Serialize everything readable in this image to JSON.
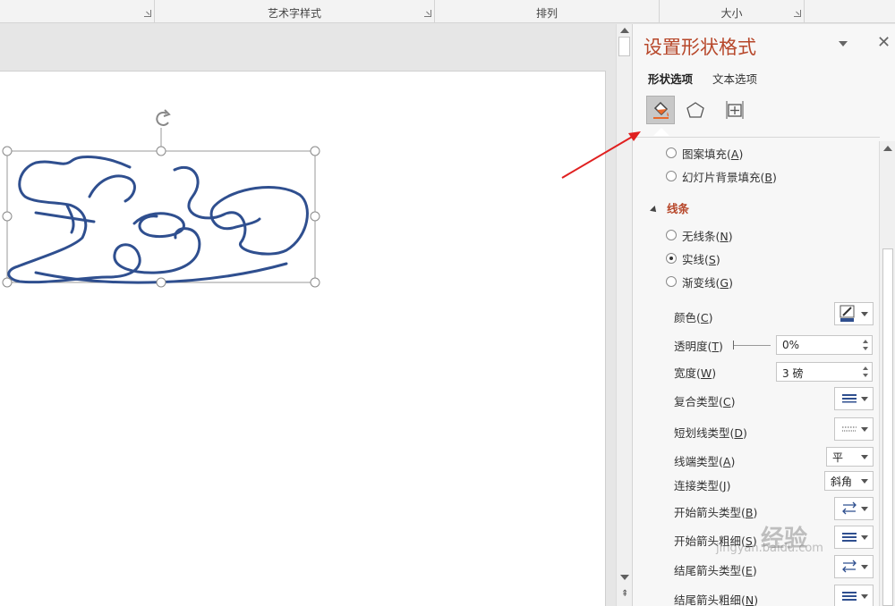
{
  "ribbon": {
    "groups": [
      {
        "label": ""
      },
      {
        "label": "艺术字样式"
      },
      {
        "label": "排列"
      },
      {
        "label": "大小"
      }
    ]
  },
  "pane": {
    "title": "设置形状格式",
    "tabs": {
      "shape": "形状选项",
      "text": "文本选项"
    },
    "icons": [
      "fill-line-icon",
      "effects-pentagon-icon",
      "size-properties-icon"
    ],
    "fill_options": [
      {
        "label": "图案填充",
        "key": "A",
        "selected": false
      },
      {
        "label": "幻灯片背景填充",
        "key": "B",
        "selected": false
      }
    ],
    "line_section": "线条",
    "line_options": [
      {
        "label": "无线条",
        "key": "N",
        "selected": false
      },
      {
        "label": "实线",
        "key": "S",
        "selected": true
      },
      {
        "label": "渐变线",
        "key": "G",
        "selected": false
      }
    ],
    "props": {
      "color": {
        "label": "颜色",
        "key": "C"
      },
      "transparency": {
        "label": "透明度",
        "key": "T",
        "value": "0%"
      },
      "width": {
        "label": "宽度",
        "key": "W",
        "value": "3 磅"
      },
      "compound": {
        "label": "复合类型",
        "key": "C"
      },
      "dash": {
        "label": "短划线类型",
        "key": "D"
      },
      "cap": {
        "label": "线端类型",
        "key": "A",
        "value": "平"
      },
      "join": {
        "label": "连接类型",
        "key": "J",
        "value": "斜角"
      },
      "begin_arrow_type": {
        "label": "开始箭头类型",
        "key": "B"
      },
      "begin_arrow_size": {
        "label": "开始箭头粗细",
        "key": "S"
      },
      "end_arrow_type": {
        "label": "结尾箭头类型",
        "key": "E"
      },
      "end_arrow_size": {
        "label": "结尾箭头粗细",
        "key": "N"
      }
    }
  },
  "colors": {
    "accent": "#b7472a",
    "ink": "#2f4f8f",
    "arrow": "#e02020"
  },
  "watermark": {
    "brand": "经验",
    "url": "jingyan.baidu.com"
  }
}
